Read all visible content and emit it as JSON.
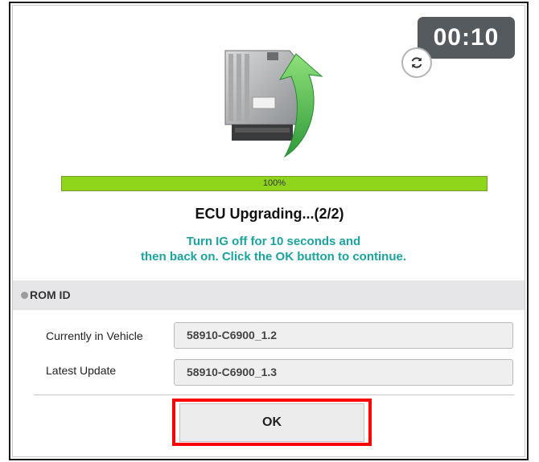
{
  "timer": "00:10",
  "progress": {
    "percent_label": "100%",
    "value": 1.0
  },
  "title": "ECU Upgrading...(2/2)",
  "message": {
    "line1": "Turn IG off for 10 seconds and",
    "line2": "then back on. Click the OK button to continue."
  },
  "rom": {
    "header": "ROM ID",
    "rows": [
      {
        "label": "Currently in Vehicle",
        "value": "58910-C6900_1.2"
      },
      {
        "label": "Latest Update",
        "value": "58910-C6900_1.3"
      }
    ]
  },
  "ok_label": "OK",
  "colors": {
    "progress": "#8ed51c",
    "message": "#1ba3a0",
    "highlight": "#ff0000",
    "timer_bg": "#555a5f"
  },
  "icons": {
    "refresh": "refresh-icon",
    "ecu": "ecu-upgrade-icon"
  }
}
